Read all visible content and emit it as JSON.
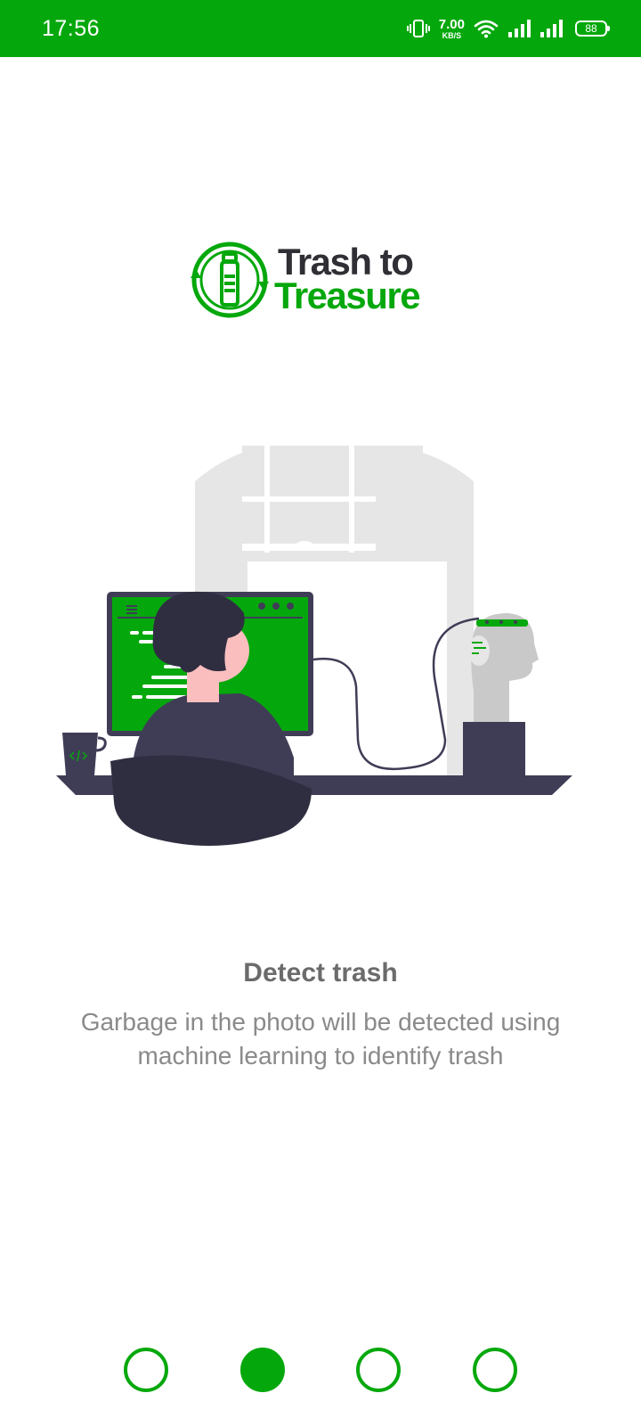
{
  "status_bar": {
    "time": "17:56",
    "net_speed_value": "7.00",
    "net_speed_unit": "KB/S",
    "battery_level": "88",
    "icons": [
      "vibrate-icon",
      "wifi-icon",
      "signal-icon",
      "signal-icon",
      "battery-icon"
    ]
  },
  "logo": {
    "line1": "Trash to",
    "line2": "Treasure"
  },
  "slide": {
    "title": "Detect trash",
    "description": "Garbage in the photo will be detected using machine learning to identify trash"
  },
  "pager": {
    "count": 4,
    "active_index": 1
  },
  "colors": {
    "accent": "#05a80c",
    "dark": "#3f3d56",
    "text_title": "#6b6b6b",
    "text_body": "#8a8a8a"
  }
}
